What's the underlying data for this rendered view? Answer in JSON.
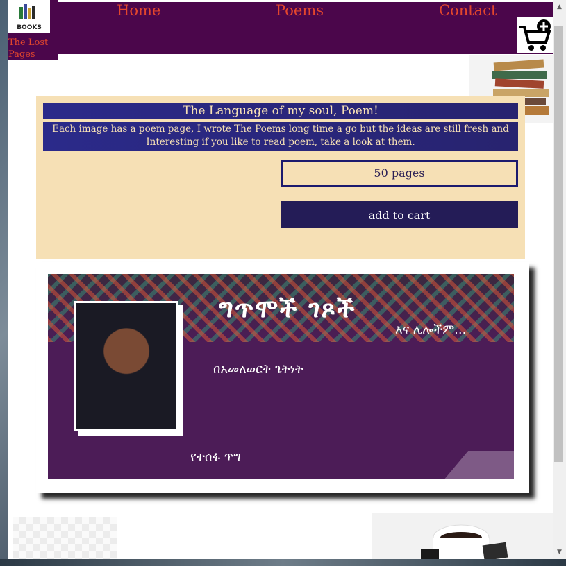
{
  "nav": {
    "home": "Home",
    "poems": "Poems",
    "contact": "Contact"
  },
  "logo": {
    "icon_label": "BOOKS",
    "site_name": "The Lost Pages"
  },
  "product": {
    "title": "The Language of my soul, Poem!",
    "description": "Each image has a poem page, I wrote The Poems long time a go but the ideas are still fresh and Interesting if you like to read poem, take a look at them.",
    "pages": "50 pages",
    "add_to_cart": "add to cart"
  },
  "poster": {
    "title": "ግጥሞች ገጾች",
    "subtitle": "እና ሌሎችም...",
    "author": "በአመለወርቅ ጌትነት",
    "bottom_text": "የተሰፋ ጥግ"
  },
  "colors": {
    "nav_bg": "#4b064b",
    "nav_link": "#e2462d",
    "card_bg": "#f6e0b5",
    "heading_bg": "#2b2a8a",
    "button_bg": "#241c57"
  },
  "icons": {
    "cart": "cart-add-icon",
    "logo": "books-logo-icon",
    "scroll_up": "chevron-up-icon",
    "scroll_down": "chevron-down-icon"
  }
}
